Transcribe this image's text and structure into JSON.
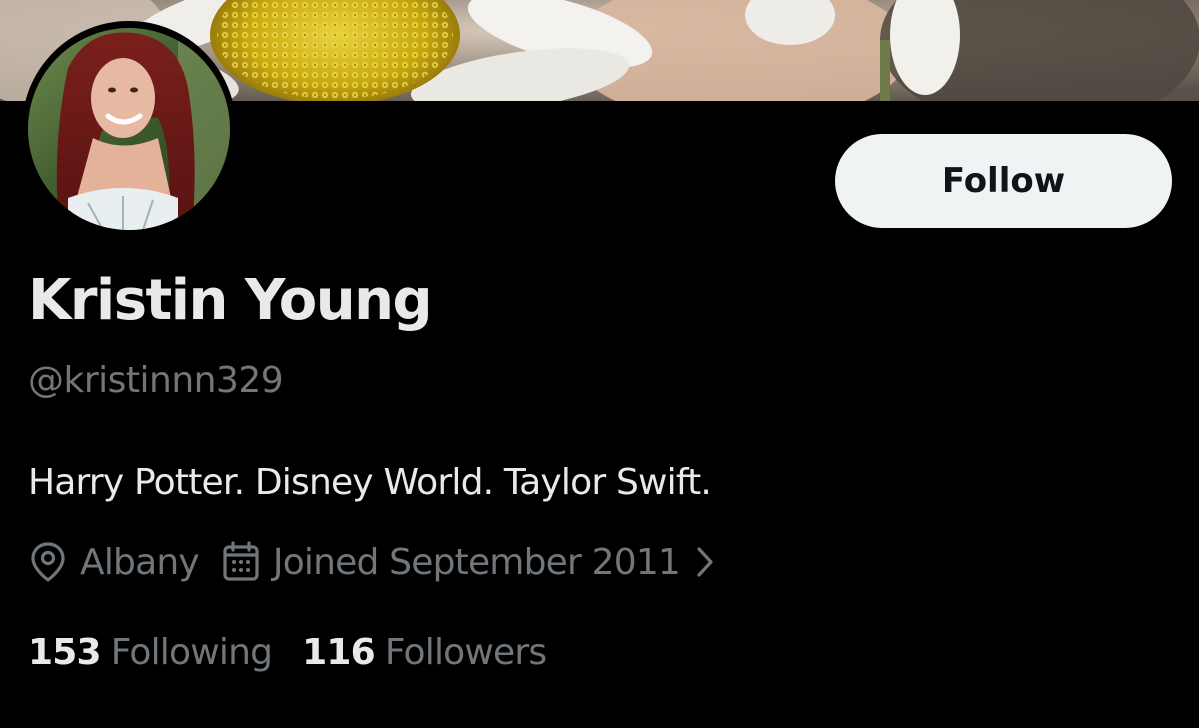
{
  "profile": {
    "display_name": "Kristin Young",
    "handle": "@kristinnn329",
    "bio": "Harry Potter. Disney World. Taylor Swift.",
    "location": "Albany",
    "joined": "Joined September 2011"
  },
  "actions": {
    "follow_label": "Follow"
  },
  "stats": {
    "following_count": "153",
    "following_label": "Following",
    "followers_count": "116",
    "followers_label": "Followers"
  },
  "icons": {
    "location": "map-pin-icon",
    "joined": "calendar-icon",
    "joined_chevron": "chevron-right-icon"
  },
  "colors": {
    "background": "#000000",
    "primary_text": "#e7e9ea",
    "secondary_text": "#71767b",
    "follow_button_bg": "#eff3f4",
    "follow_button_text": "#0f1419"
  }
}
